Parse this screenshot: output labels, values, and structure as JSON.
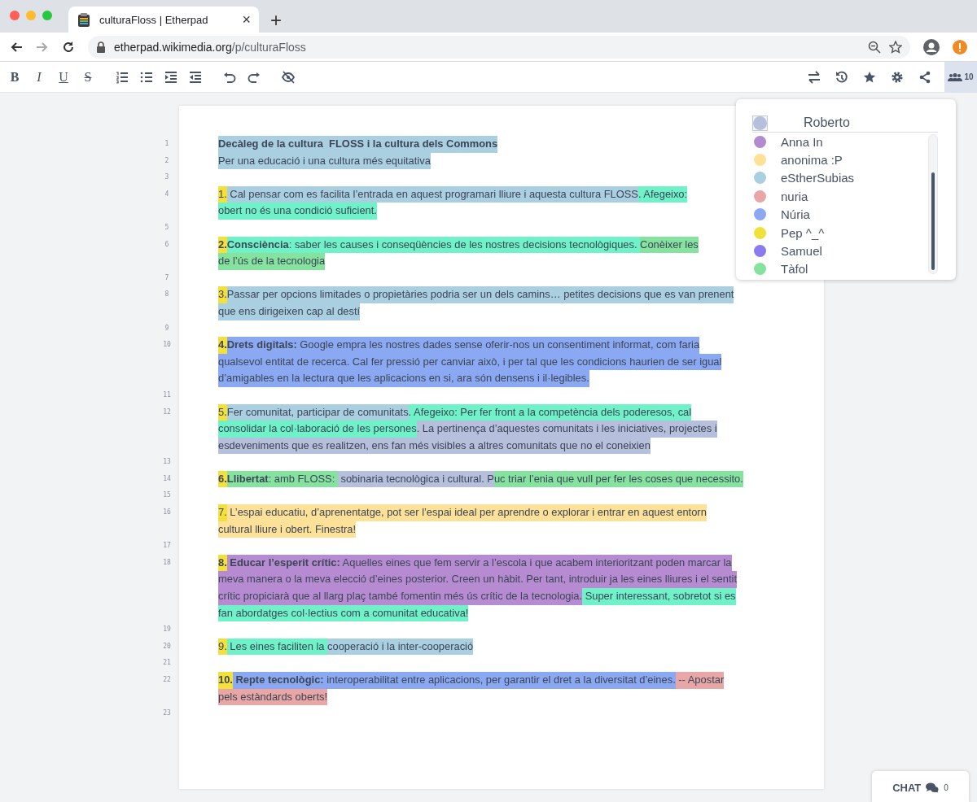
{
  "browser": {
    "tab": {
      "title": "culturaFloss | Etherpad",
      "close": "×"
    },
    "new_tab": "+",
    "address": {
      "host": "etherpad.wikimedia.org",
      "path": "/p/culturaFloss"
    }
  },
  "toolbar": {
    "format_buttons": [
      {
        "label": "B",
        "kind": "bold"
      },
      {
        "label": "I",
        "kind": "italic"
      },
      {
        "label": "U",
        "kind": "underline"
      },
      {
        "label": "S",
        "kind": "strike"
      }
    ],
    "users_button": {
      "count": "10",
      "selected": true
    }
  },
  "document": {
    "lines": [
      {
        "number": "1",
        "visual_lines": [
          {
            "spans": [
              {
                "text": "Decàleg de la cultura  FLOSS i la cultura dels Commons",
                "color": "#a9cfe0",
                "bold": true
              }
            ]
          }
        ]
      },
      {
        "number": "2",
        "visual_lines": [
          {
            "spans": [
              {
                "text": "Per una educació i una cultura més equitativa",
                "color": "#a9cfe0"
              }
            ]
          }
        ]
      },
      {
        "number": "3"
      },
      {
        "number": "4",
        "visual_lines": [
          {
            "spans": [
              {
                "text": "1.",
                "color": "#f3e03a"
              },
              {
                "text": " Cal pensar com es facilita l’entrada en aquest programari lliure i aquesta cultura FLOSS",
                "color": "#a9cfe0"
              },
              {
                "text": ". Afegeixo:",
                "color": "#70f2c8"
              }
            ]
          },
          {
            "spans": [
              {
                "text": "obert no és una condició suficient.",
                "color": "#70f2c8"
              }
            ]
          }
        ]
      },
      {
        "number": "5"
      },
      {
        "number": "6",
        "visual_lines": [
          {
            "spans": [
              {
                "text": "2.",
                "color": "#f3e03a",
                "bold": true
              },
              {
                "text": "Consciència",
                "color": "#70f2c8",
                "bold": true
              },
              {
                "text": ": saber les causes i conseqüències de les nostres decisions tecnològiques. ",
                "color": "#70f2c8"
              },
              {
                "text": "Conèixer les",
                "color": "#85e39f"
              }
            ]
          },
          {
            "spans": [
              {
                "text": "de l’ús de la tecnologia",
                "color": "#85e39f"
              }
            ]
          }
        ]
      },
      {
        "number": "7"
      },
      {
        "number": "8",
        "visual_lines": [
          {
            "spans": [
              {
                "text": "3.",
                "color": "#f3e03a"
              },
              {
                "text": "Passar per opcions limitades o propietàries podria ser un dels camins… petites decisions que es van prenent",
                "color": "#a9cfe0"
              }
            ]
          },
          {
            "spans": [
              {
                "text": "que ens dirigeixen cap al destí",
                "color": "#a9cfe0"
              }
            ]
          }
        ]
      },
      {
        "number": "9"
      },
      {
        "number": "10",
        "visual_lines": [
          {
            "spans": [
              {
                "text": "4.",
                "color": "#f3e03a",
                "bold": true
              },
              {
                "text": "Drets digitals:",
                "color": "#8ba8f2",
                "bold": true
              },
              {
                "text": " Google empra les nostres dades sense oferir-nos un consentiment informat, com faria",
                "color": "#8ba8f2"
              }
            ]
          },
          {
            "spans": [
              {
                "text": "qualsevol entitat de recerca. Cal fer pressió per canviar això, i per tal que les condicions haurien de ser igual",
                "color": "#8ba8f2"
              }
            ]
          },
          {
            "spans": [
              {
                "text": "d’amigables en la lectura que les aplicacions en si, ara són densens i il·legibles.",
                "color": "#8ba8f2"
              }
            ]
          }
        ]
      },
      {
        "number": "11"
      },
      {
        "number": "12",
        "visual_lines": [
          {
            "spans": [
              {
                "text": "5.",
                "color": "#f3e03a"
              },
              {
                "text": "Fer comunitat, participar de comunitats",
                "color": "#a9cfe0"
              },
              {
                "text": ". Afegeixo: Per fer front a la competència dels poderesos, cal",
                "color": "#70f2c8"
              }
            ]
          },
          {
            "spans": [
              {
                "text": "consolidar la col·laboració de les persones",
                "color": "#70f2c8"
              },
              {
                "text": ". La pertinença d’aquestes comunitats i les iniciatives, projectes i",
                "color": "#b6bfdc"
              }
            ]
          },
          {
            "spans": [
              {
                "text": "esdeveniments que es realitzen, ens fan més visibles a altres comunitats que no el coneixien",
                "color": "#b6bfdc"
              }
            ]
          }
        ]
      },
      {
        "number": "13"
      },
      {
        "number": "14",
        "visual_lines": [
          {
            "spans": [
              {
                "text": "6.",
                "color": "#f3e03a",
                "bold": true
              },
              {
                "text": "Llibertat",
                "color": "#85e39f",
                "bold": true
              },
              {
                "text": ": amb FLOSS: ",
                "color": "#85e39f"
              },
              {
                "text": " sobinaria tecnològica i cultural. P",
                "color": "#b6bfdc"
              },
              {
                "text": "uc triar l’enia que vull per fer les coses que necessito.",
                "color": "#85e39f"
              }
            ]
          }
        ]
      },
      {
        "number": "15"
      },
      {
        "number": "16",
        "visual_lines": [
          {
            "spans": [
              {
                "text": "7.",
                "color": "#f3e03a"
              },
              {
                "text": " L’espai educatiu, d’aprenentatge, pot ser l’espai ideal per aprendre o explorar i entrar en aquest entorn",
                "color": "#fde199"
              }
            ]
          },
          {
            "spans": [
              {
                "text": "cultural lliure i obert. Finestra!",
                "color": "#fde199"
              }
            ]
          }
        ]
      },
      {
        "number": "17"
      },
      {
        "number": "18",
        "visual_lines": [
          {
            "spans": [
              {
                "text": "8.",
                "color": "#f3e03a",
                "bold": true
              },
              {
                "text": " Educar l’esperit crític:",
                "color": "#b68bd1",
                "bold": true
              },
              {
                "text": " Aquelles eines que fem servir a l’escola i que acabem interioritzant poden marcar la",
                "color": "#b68bd1"
              }
            ]
          },
          {
            "spans": [
              {
                "text": "meva manera o la meva elecció d’eines posterior. Creen un hàbit. Per tant, introduir ja les eines lliures i el sentit",
                "color": "#b68bd1"
              }
            ]
          },
          {
            "spans": [
              {
                "text": "crític propiciarà que al llarg plaç també fomentin més ús crític de la tecnologia.",
                "color": "#b68bd1"
              },
              {
                "text": " Super interessant, sobretot si es",
                "color": "#70f2c8"
              }
            ]
          },
          {
            "spans": [
              {
                "text": "fan abordatges col·lectius com a comunitat educativa!",
                "color": "#70f2c8"
              }
            ]
          }
        ]
      },
      {
        "number": "19"
      },
      {
        "number": "20",
        "visual_lines": [
          {
            "spans": [
              {
                "text": "9.",
                "color": "#f3e03a"
              },
              {
                "text": " Les eines faciliten la ",
                "color": "#70f2c8"
              },
              {
                "text": "cooperació i la inter-cooperació",
                "color": "#a9cfe0"
              }
            ]
          }
        ]
      },
      {
        "number": "21"
      },
      {
        "number": "22",
        "visual_lines": [
          {
            "spans": [
              {
                "text": "10.",
                "color": "#f3e03a",
                "bold": true
              },
              {
                "text": " Repte tecnològic:",
                "color": "#8ba8f2",
                "bold": true
              },
              {
                "text": " interoperabilitat entre aplicacions, per garantir el dret a la diversitat d’eines.",
                "color": "#8ba8f2"
              },
              {
                "text": " -- Apostar",
                "color": "#e8a6a6"
              }
            ]
          },
          {
            "spans": [
              {
                "text": "pels estàndards oberts!",
                "color": "#e8a6a6"
              }
            ]
          }
        ]
      },
      {
        "number": "23"
      }
    ]
  },
  "users_panel": {
    "own": {
      "name": "Roberto",
      "color": "#b6bfdc"
    },
    "users": [
      {
        "name": "Anna In",
        "color": "#b38ad0"
      },
      {
        "name": "anonima :P",
        "color": "#fde199"
      },
      {
        "name": "eStherSubias",
        "color": "#a9cfe0"
      },
      {
        "name": "nuria",
        "color": "#e8a6a6"
      },
      {
        "name": "Núria",
        "color": "#8ba8f2"
      },
      {
        "name": "Pep ^_^",
        "color": "#f0e13a"
      },
      {
        "name": "Samuel",
        "color": "#8b7bef"
      },
      {
        "name": "Tàfol",
        "color": "#85e39f"
      }
    ]
  },
  "chat": {
    "label": "CHAT",
    "count": "0"
  }
}
